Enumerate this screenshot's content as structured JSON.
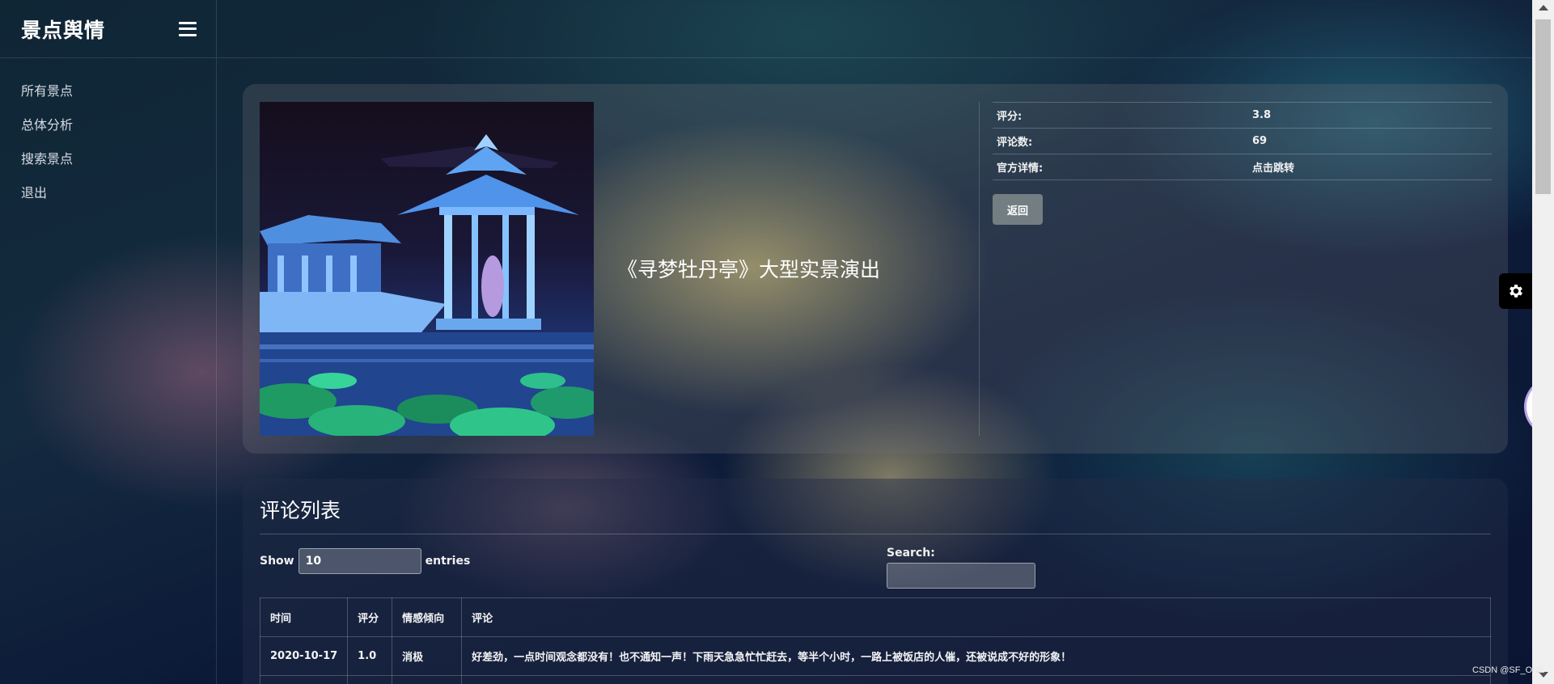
{
  "app": {
    "title": "景点舆情"
  },
  "sidebar": {
    "items": [
      {
        "label": "所有景点"
      },
      {
        "label": "总体分析"
      },
      {
        "label": "搜索景点"
      },
      {
        "label": "退出"
      }
    ]
  },
  "detail": {
    "title": "《寻梦牡丹亭》大型实景演出",
    "rows": [
      {
        "label": "评分:",
        "value": "3.8"
      },
      {
        "label": "评论数:",
        "value": "69"
      },
      {
        "label": "官方详情:",
        "value": "点击跳转"
      }
    ],
    "back_label": "返回"
  },
  "comments": {
    "title": "评论列表",
    "show_label": "Show",
    "entries_label": "entries",
    "page_length": "10",
    "search_label": "Search:",
    "search_value": "",
    "columns": [
      "时间",
      "评分",
      "情感倾向",
      "评论"
    ],
    "rows": [
      [
        "2020-10-17",
        "1.0",
        "消极",
        "好差劲，一点时间观念都没有！也不通知一声！下雨天急急忙忙赶去，等半个小时，一路上被饭店的人催，还被说成不好的形象！"
      ]
    ]
  },
  "icons": {
    "menu": "hamburger-icon",
    "settings": "gear-icon",
    "widget": "floating-logo-icon"
  },
  "watermark": "CSDN @SF_ONE"
}
